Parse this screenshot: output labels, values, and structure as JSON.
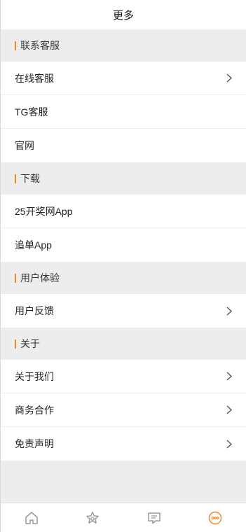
{
  "header": {
    "title": "更多"
  },
  "sections": [
    {
      "title": "联系客服",
      "items": [
        {
          "label": "在线客服",
          "chevron": true
        },
        {
          "label": "TG客服",
          "chevron": false
        },
        {
          "label": "官网",
          "chevron": false
        }
      ]
    },
    {
      "title": "下载",
      "items": [
        {
          "label": "25开奖网App",
          "chevron": false
        },
        {
          "label": "追单App",
          "chevron": false
        }
      ]
    },
    {
      "title": "用户体验",
      "items": [
        {
          "label": "用户反馈",
          "chevron": true
        }
      ]
    },
    {
      "title": "关于",
      "items": [
        {
          "label": "关于我们",
          "chevron": true
        },
        {
          "label": "商务合作",
          "chevron": true
        },
        {
          "label": "免责声明",
          "chevron": true
        }
      ]
    }
  ],
  "tabbar": {
    "tabs": [
      {
        "icon": "home-icon",
        "active": false
      },
      {
        "icon": "star-icon",
        "active": false
      },
      {
        "icon": "chat-icon",
        "active": false
      },
      {
        "icon": "more-icon",
        "active": true
      }
    ]
  },
  "colors": {
    "accent": "#f08a24",
    "section_bg": "#ededed",
    "text": "#222222",
    "icon_inactive": "#9a9a9a"
  }
}
